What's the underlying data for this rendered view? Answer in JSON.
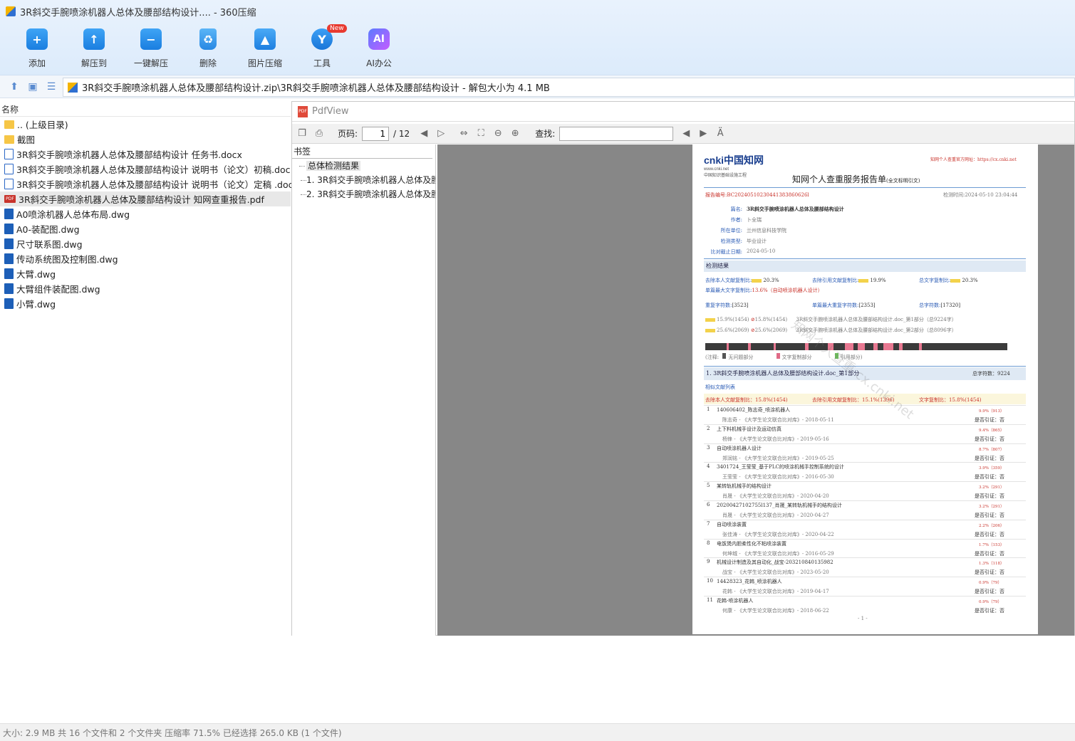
{
  "window": {
    "title": "3R斜交手腕喷涂机器人总体及腰部结构设计.... - 360压缩"
  },
  "toolbar": {
    "add": "添加",
    "extract_to": "解压到",
    "one_click_extract": "一键解压",
    "delete": "删除",
    "image_compress": "图片压缩",
    "tools": "工具",
    "tools_badge": "New",
    "ai_office": "AI办公",
    "ai_icon_text": "AI"
  },
  "address": {
    "path": "3R斜交手腕喷涂机器人总体及腰部结构设计.zip\\3R斜交手腕喷涂机器人总体及腰部结构设计 - 解包大小为 4.1 MB"
  },
  "filelist": {
    "header": "名称",
    "items": [
      {
        "name": ".. (上级目录)",
        "type": "folder"
      },
      {
        "name": "截图",
        "type": "folder"
      },
      {
        "name": "3R斜交手腕喷涂机器人总体及腰部结构设计 任务书.docx",
        "type": "doc"
      },
      {
        "name": "3R斜交手腕喷涂机器人总体及腰部结构设计 说明书（论文）初稿.doc",
        "type": "doc"
      },
      {
        "name": "3R斜交手腕喷涂机器人总体及腰部结构设计 说明书（论文）定稿 .doc",
        "type": "doc"
      },
      {
        "name": "3R斜交手腕喷涂机器人总体及腰部结构设计 知网查重报告.pdf",
        "type": "pdf"
      },
      {
        "name": "A0喷涂机器人总体布局.dwg",
        "type": "dwg"
      },
      {
        "name": "A0-装配图.dwg",
        "type": "dwg"
      },
      {
        "name": "尺寸联系图.dwg",
        "type": "dwg"
      },
      {
        "name": "传动系统图及控制图.dwg",
        "type": "dwg"
      },
      {
        "name": "大臂.dwg",
        "type": "dwg"
      },
      {
        "name": "大臂组件装配图.dwg",
        "type": "dwg"
      },
      {
        "name": "小臂.dwg",
        "type": "dwg"
      }
    ]
  },
  "viewer": {
    "title": "PdfView",
    "pdf_icon_text": "PDF",
    "page_label": "页码:",
    "page_current": "1",
    "page_total": "/ 12",
    "find_label": "查找:",
    "bookmarks_title": "书签",
    "bookmarks": [
      "总体检测结果",
      "1. 3R斜交手腕喷涂机器人总体及腰部结构设计",
      "2. 3R斜交手腕喷涂机器人总体及腰部结构设计"
    ]
  },
  "report": {
    "logo": "cnki中国知网",
    "logo_url": "www.cnki.net",
    "logo_sub": "中国知识基础设施工程",
    "top_right": "知网个人查重官方网址：https://cx.cnki.net",
    "title": "知网个人查重服务报告单",
    "title_note": "(全文标明引文)",
    "report_no": "报告编号:BC20240510230441383860626l",
    "check_time": "检测时间:2024-05-10 23:04:44",
    "fields": [
      {
        "k": "篇名:",
        "v": "3R斜交手腕喷涂机器人总体及腰部结构设计"
      },
      {
        "k": "作者:",
        "v": "卜全瑞"
      },
      {
        "k": "所在单位:",
        "v": "兰州信息科技学院"
      },
      {
        "k": "检测类型:",
        "v": "毕业设计"
      },
      {
        "k": "比对截止日期:",
        "v": "2024-05-10"
      }
    ],
    "result_title": "检测结果",
    "r1a": "去除本人文献复制比:",
    "r1a_v": "20.3%",
    "r1b": "去除引用文献复制比:",
    "r1b_v": "19.9%",
    "r1c": "总文字复制比:",
    "r1c_v": "20.3%",
    "r2": "单篇最大文字复制比:",
    "r2_v": "13.6%（自动喷涂机器人设计）",
    "r3a": "重复字符数:",
    "r3a_v": "[3523]",
    "r3b": "单篇最大重复字符数:",
    "r3b_v": "[2353]",
    "r3c": "总字符数:",
    "r3c_v": "[17320]",
    "p1": "15.9%(1454)",
    "p1b": "15.8%(1454)",
    "p1t": "3R斜交手腕喷涂机器人总体及腰部结构设计.doc_第1部分（总9224字）",
    "p2": "25.6%(2069)",
    "p2b": "25.6%(2069)",
    "p2t": "3R斜交手腕喷涂机器人总体及腰部结构设计.doc_第2部分（总8096字）",
    "legend_note": "(注释:",
    "legend_none": "无问题部分",
    "legend_copy": "文字复制部分",
    "legend_cite": "引用部分)",
    "sec1_title": "1. 3R斜交手腕喷涂机器人总体及腰部结构设计.doc_第1部分",
    "sec1_total": "总字符数：9224",
    "similar_list": "相似文献列表",
    "s1a": "去除本人文献复制比：15.8%(1454)",
    "s1b": "去除引用文献复制比：15.1%(1396)",
    "s1c": "文字复制比：15.8%(1454)",
    "entries": [
      {
        "n": "1",
        "t": "140606402_陈志奇_喷涂机器人",
        "p": "9.9%（913）",
        "s": "陈志奇 - 《大学生论文联合比对库》- 2018-05-11",
        "c": "是否引证：否"
      },
      {
        "n": "2",
        "t": "上下料机械手设计及运动仿真",
        "p": "9.4%（865）",
        "s": "杨锋 - 《大学生论文联合比对库》- 2019-05-16",
        "c": "是否引证：否"
      },
      {
        "n": "3",
        "t": "自动喷涂机器人设计",
        "p": "8.7%（807）",
        "s": "郑润铭 - 《大学生论文联合比对库》- 2019-05-25",
        "c": "是否引证：否"
      },
      {
        "n": "4",
        "t": "3401724_王莹莹_基于PLC的喷涂机械手控制系统的设计",
        "p": "3.9%（359）",
        "s": "王莹莹 - 《大学生论文联合比对库》- 2016-05-30",
        "c": "是否引证：否"
      },
      {
        "n": "5",
        "t": "某转轨机械手的结构设计",
        "p": "3.2%（291）",
        "s": "肖晟 - 《大学生论文联合比对库》- 2020-04-20",
        "c": "是否引证：否"
      },
      {
        "n": "6",
        "t": "20200427102755l137_肖晟_某转轨机械手的结构设计",
        "p": "3.2%（291）",
        "s": "肖晟 - 《大学生论文联合比对库》- 2020-04-27",
        "c": "是否引证：否"
      },
      {
        "n": "7",
        "t": "自动喷涂装置",
        "p": "2.2%（206）",
        "s": "张佳涛 - 《大学生论文联合比对库》- 2020-04-22",
        "c": "是否引证：否"
      },
      {
        "n": "8",
        "t": "电饭煲内胆柔性化不粘喷涂装置",
        "p": "1.7%（153）",
        "s": "何坤城 - 《大学生论文联合比对库》- 2016-05-29",
        "c": "是否引证：否"
      },
      {
        "n": "9",
        "t": "机械设计制造及其自动化_战宝-2032108401359​82",
        "p": "1.3%（118）",
        "s": "战宝 - 《大学生论文联合比对库》- 2023-05-20",
        "c": "是否引证：否"
      },
      {
        "n": "10",
        "t": "14428323_花韩_喷涂机器人",
        "p": "0.9%（79）",
        "s": "花韩 - 《大学生论文联合比对库》- 2019-04-17",
        "c": "是否引证：否"
      },
      {
        "n": "11",
        "t": "花韩-喷涂机器人",
        "p": "0.9%（79）",
        "s": "何康 - 《大学生论文联合比对库》- 2018-06-22",
        "c": "是否引证：否"
      }
    ],
    "page_no": "- 1 -",
    "watermark": "知网个人查重 cx.cnki.net"
  },
  "status": {
    "text": "大小: 2.9 MB 共 16 个文件和 2 个文件夹 压缩率 71.5% 已经选择 265.0 KB (1 个文件)"
  }
}
